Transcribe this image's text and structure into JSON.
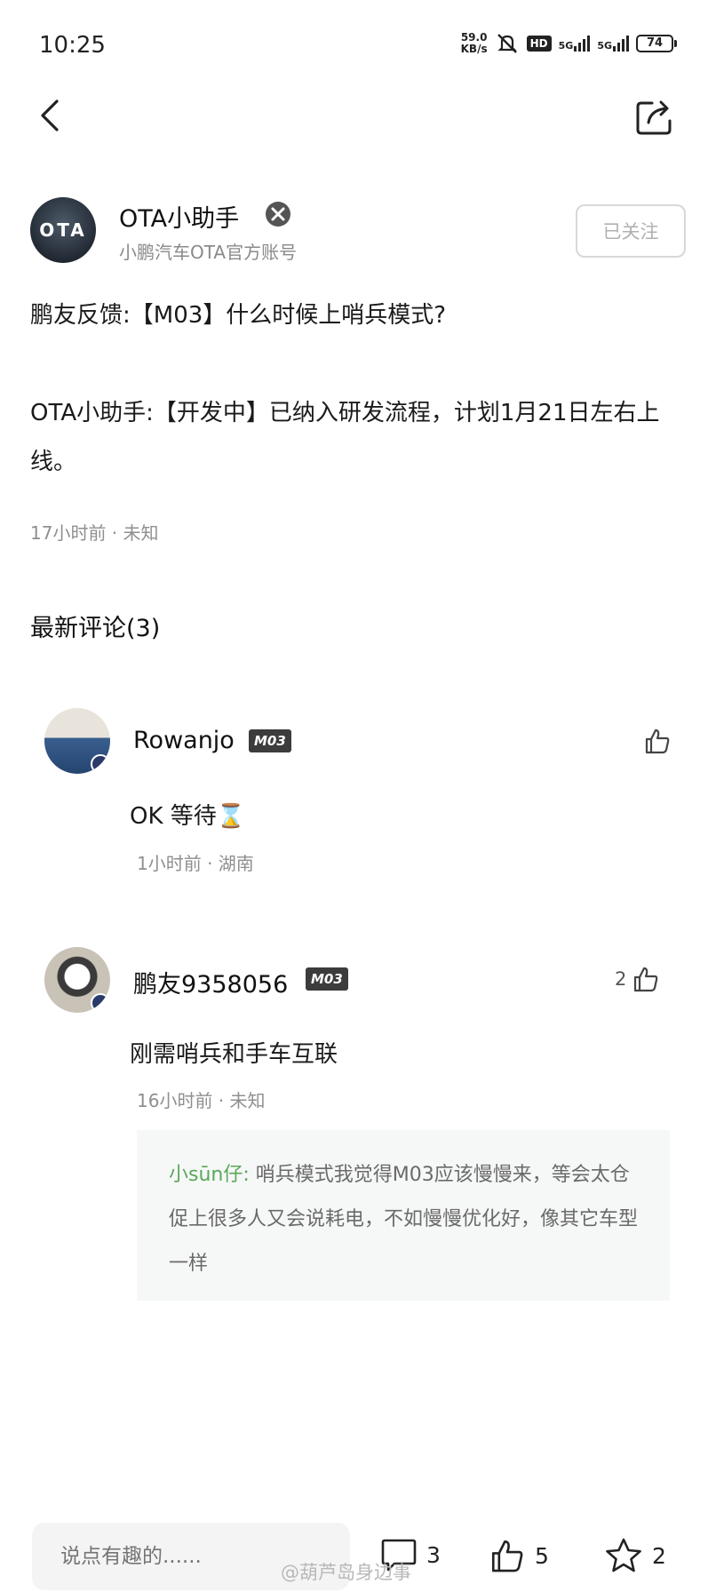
{
  "status_bar": {
    "time": "10:25",
    "net_speed_value": "59.0",
    "net_speed_unit": "KB/s",
    "hd_label": "HD",
    "signal_1": "5G",
    "signal_2": "5G",
    "battery": "74"
  },
  "author": {
    "avatar_text": "OTA",
    "name": "OTA小助手",
    "description": "小鹏汽车OTA官方账号",
    "follow_label": "已关注"
  },
  "post": {
    "line1": "鹏友反馈:【M03】什么时候上哨兵模式?",
    "line2": "OTA小助手:【开发中】已纳入研发流程，计划1月21日左右上线。",
    "meta": "17小时前 · 未知"
  },
  "comments_section": {
    "title": "最新评论(3)",
    "comments": [
      {
        "name": "Rowanjo",
        "car_tag": "M03",
        "text": "OK 等待⌛",
        "meta": "1小时前 · 湖南",
        "likes": ""
      },
      {
        "name": "鹏友9358056",
        "car_tag": "M03",
        "text": "刚需哨兵和手车互联",
        "meta": "16小时前 · 未知",
        "likes": "2",
        "reply": {
          "user": "小sūn仔:",
          "text": " 哨兵模式我觉得M03应该慢慢来，等会太仓促上很多人又会说耗电，不如慢慢优化好，像其它车型一样"
        }
      }
    ]
  },
  "bottom_bar": {
    "input_placeholder": "说点有趣的......",
    "comment_count": "3",
    "like_count": "5",
    "favorite_count": "2"
  },
  "watermark": "@葫芦岛身边事",
  "colors": {
    "reply_user": "#5aa85a",
    "muted_text": "#8f8f8f",
    "car_tag_bg": "#3c3c3c"
  }
}
